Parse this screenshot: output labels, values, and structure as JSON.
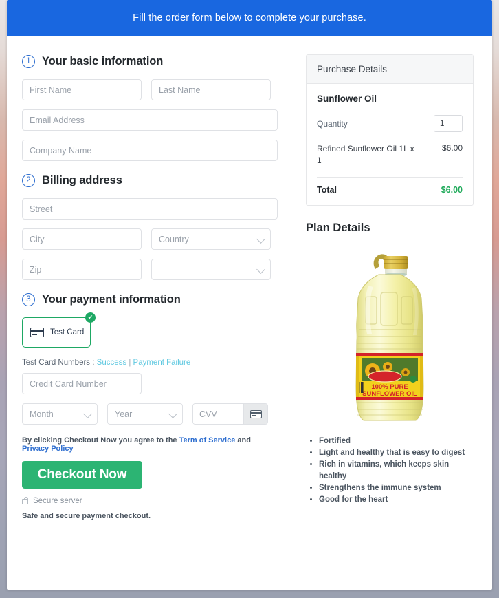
{
  "banner": {
    "text": "Fill the order form below to complete your purchase."
  },
  "steps": {
    "basic": {
      "num": "1",
      "title": "Your basic information"
    },
    "billing": {
      "num": "2",
      "title": "Billing address"
    },
    "payment": {
      "num": "3",
      "title": "Your payment information"
    }
  },
  "form": {
    "first_name": "First Name",
    "last_name": "Last Name",
    "email": "Email Address",
    "company": "Company Name",
    "street": "Street",
    "city": "City",
    "country": "Country",
    "zip": "Zip",
    "state": "-",
    "credit_card_number": "Credit Card Number",
    "month": "Month",
    "year": "Year",
    "cvv": "CVV"
  },
  "payment": {
    "tile_label": "Test Card",
    "check_icon": "✔",
    "test_numbers_label": "Test Card Numbers :",
    "success_link": "Success",
    "separator": "|",
    "failure_link": "Payment Failure"
  },
  "terms": {
    "prefix": "By clicking Checkout Now you agree to the",
    "tos": "Term of Service",
    "and": "and",
    "privacy": "Privacy Policy"
  },
  "actions": {
    "checkout_label": "Checkout Now",
    "secure_server": "Secure server",
    "safe_note": "Safe and secure payment checkout."
  },
  "purchase": {
    "header": "Purchase Details",
    "product": "Sunflower Oil",
    "quantity_label": "Quantity",
    "quantity_value": "1",
    "line_desc": "Refined Sunflower Oil 1L x 1",
    "line_amount": "$6.00",
    "total_label": "Total",
    "total_amount": "$6.00"
  },
  "plan": {
    "title": "Plan Details",
    "product_image_alt": "sunflower-oil-bottle",
    "label_line1": "100% PURE",
    "label_line2": "SUNFLOWER OIL",
    "features": [
      "Fortified",
      "Light and healthy that is easy to digest",
      "Rich in vitamins, which keeps skin healthy",
      "Strengthens the immune system",
      "Good for the heart"
    ]
  },
  "colors": {
    "banner_blue": "#1967e0",
    "step_blue": "#2f6fd0",
    "success_green": "#2cb473",
    "tile_green": "#1ea864",
    "total_green": "#1faa5a",
    "link_cyan": "#5ec8e0"
  }
}
